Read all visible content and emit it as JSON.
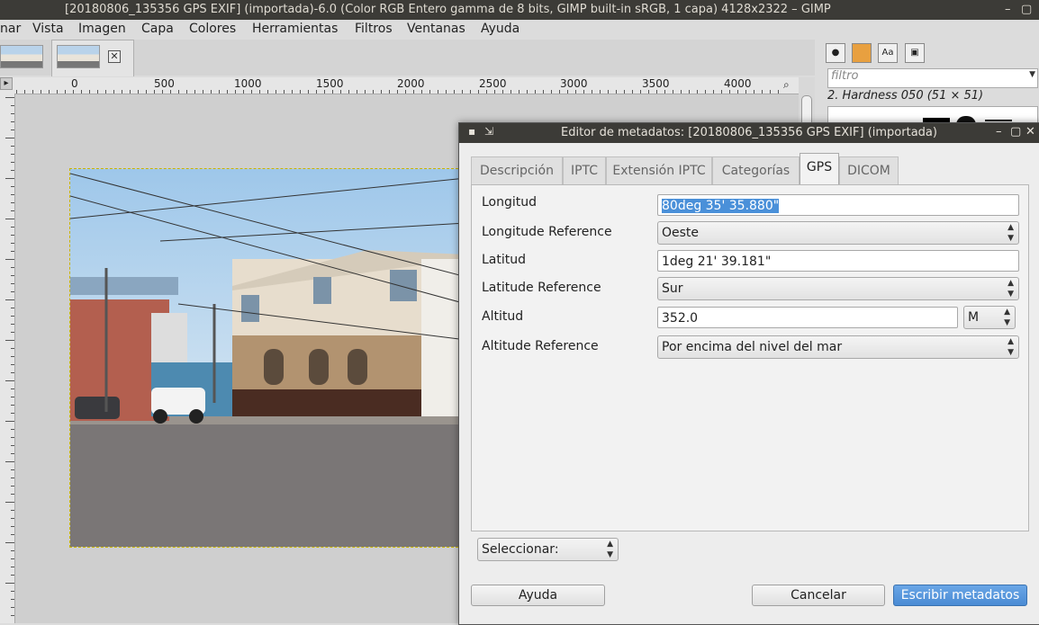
{
  "window": {
    "title": "[20180806_135356 GPS EXIF] (importada)-6.0 (Color RGB Entero gamma de 8 bits, GIMP built-in sRGB, 1 capa) 4128x2322 – GIMP"
  },
  "menu": [
    "nar",
    "Vista",
    "Imagen",
    "Capa",
    "Colores",
    "Herramientas",
    "Filtros",
    "Ventanas",
    "Ayuda"
  ],
  "ruler": {
    "labels": [
      "0",
      "500",
      "1000",
      "1500",
      "2000",
      "2500",
      "3000",
      "3500",
      "4000"
    ]
  },
  "dock": {
    "filter_placeholder": "filtro",
    "brush_label": "2. Hardness 050 (51 × 51)",
    "text_tool_label": "Aa"
  },
  "dialog": {
    "title": "Editor de metadatos: [20180806_135356 GPS EXIF] (importada)",
    "tabs": [
      "Descripción",
      "IPTC",
      "Extensión IPTC",
      "Categorías",
      "GPS",
      "DICOM"
    ],
    "active_tab": "GPS",
    "fields": {
      "longitude_label": "Longitud",
      "longitude_value": "80deg 35' 35.880\"",
      "longitude_ref_label": "Longitude Reference",
      "longitude_ref_value": "Oeste",
      "latitude_label": "Latitud",
      "latitude_value": "1deg 21' 39.181\"",
      "latitude_ref_label": "Latitude Reference",
      "latitude_ref_value": "Sur",
      "altitude_label": "Altitud",
      "altitude_value": "352.0",
      "altitude_unit": "M",
      "altitude_ref_label": "Altitude Reference",
      "altitude_ref_value": "Por encima del nivel del mar"
    },
    "select_label": "Seleccionar:",
    "buttons": {
      "help": "Ayuda",
      "cancel": "Cancelar",
      "write": "Escribir metadatos"
    }
  },
  "colors": {
    "titlebar": "#3c3b37",
    "accent": "#4a90d9"
  }
}
